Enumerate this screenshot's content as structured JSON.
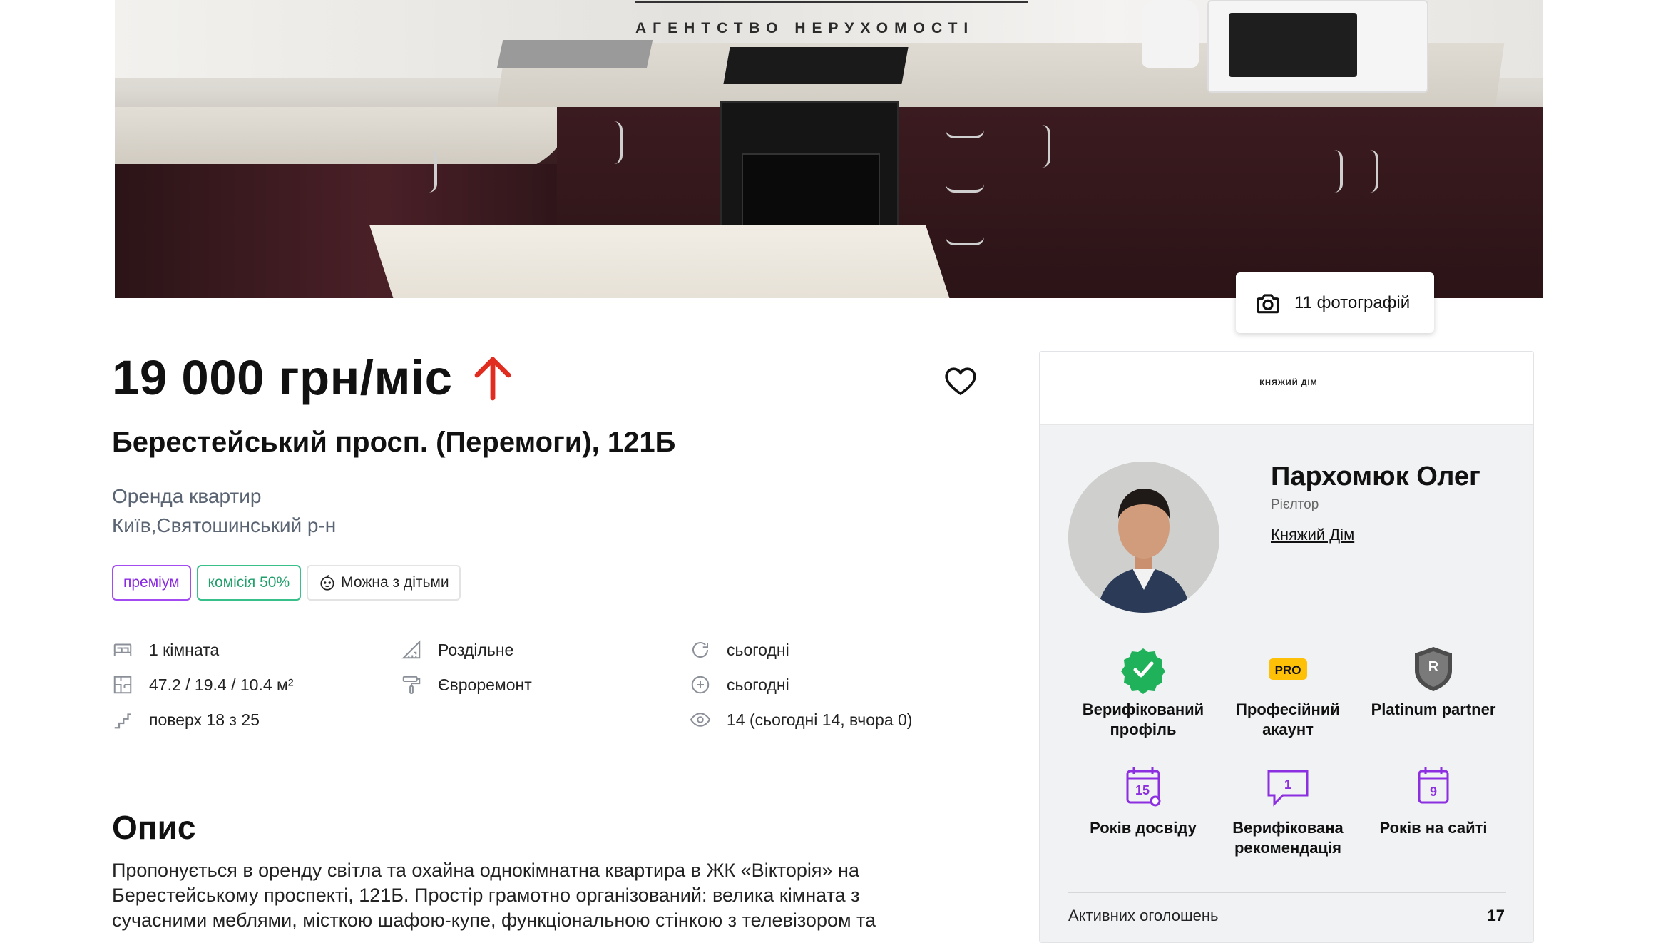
{
  "hero": {
    "watermark": "АГЕНТСТВО НЕРУХОМОСТІ",
    "photos_button_label": "11 фотографій"
  },
  "listing": {
    "price": "19 000 грн/міс",
    "price_trend_icon": "arrow-up-icon",
    "address": "Берестейський просп. (Перемоги), 121Б",
    "category": "Оренда квартир",
    "location": "Київ,Святошинський р-н",
    "badges": {
      "premium": "преміум",
      "commission": "комісія 50%",
      "kids": "Можна з дітьми"
    },
    "properties": {
      "rooms": "1 кімната",
      "area": "47.2 / 19.4 / 10.4 м²",
      "floor": "поверх 18 з 25",
      "bathroom": "Роздільне",
      "renovation": "Євроремонт",
      "updated": "сьогодні",
      "created": "сьогодні",
      "views": "14 (сьогодні 14, вчора 0)"
    },
    "description_title": "Опис",
    "description_lines": [
      "Пропонується в оренду світла та охайна однокімнатна квартира в ЖК «Вікторія» на",
      "Берестейському проспекті, 121Б. Простір грамотно організований: велика кімната з",
      "сучасними меблями, місткою шафою-купе, функціональною стінкою з телевізором та"
    ]
  },
  "agent": {
    "logo_text": "КНЯЖИЙ ДІМ",
    "name": "Пархомюк Олег",
    "role": "Рієлтор",
    "agency": "Княжий Дім",
    "achievements": {
      "verified": "Верифікований профіль",
      "pro": "Професійний акаунт",
      "pro_badge": "PRO",
      "platinum": "Platinum partner",
      "platinum_badge": "R",
      "experience": "Років досвіду",
      "experience_value": "15",
      "recommendation": "Верифікована рекомендація",
      "recommendation_value": "1",
      "years_on_site": "Років на сайті",
      "years_on_site_value": "9"
    },
    "active_listings_label": "Активних оголошень",
    "active_listings_count": "17"
  },
  "colors": {
    "price_up": "#e02d20",
    "premium": "#8a2be2",
    "commission": "#22a06b",
    "verified_green": "#1fb25a",
    "pro_yellow": "#ffc107",
    "purple_icons": "#8b2fe0"
  }
}
